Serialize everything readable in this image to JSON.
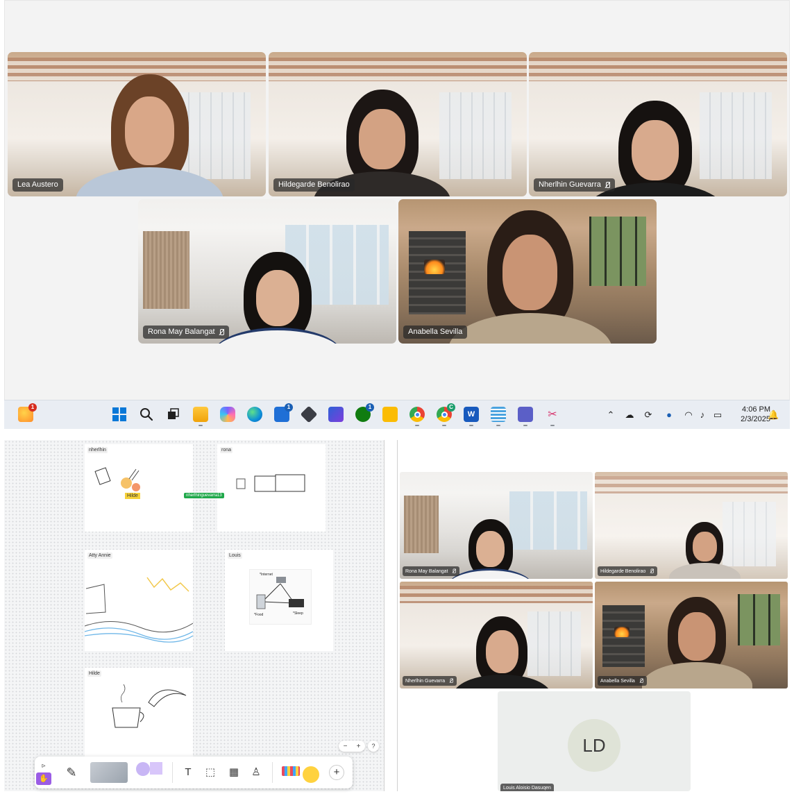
{
  "top_meeting": {
    "participants": [
      {
        "name": "Lea Austero",
        "muted": false
      },
      {
        "name": "Hildegarde Benolirao",
        "muted": false
      },
      {
        "name": "Nherlhin Guevarra",
        "muted": true
      },
      {
        "name": "Rona May Balangat",
        "muted": true
      },
      {
        "name": "Anabella Sevilla",
        "muted": false
      }
    ]
  },
  "taskbar": {
    "weather_badge": "1",
    "store_badge": "1",
    "xbox_badge": "1",
    "chrome_badge": "C",
    "time": "4:06 PM",
    "date": "2/3/2025",
    "icons": [
      "weather-icon",
      "start-icon",
      "search-icon",
      "task-view-icon",
      "file-explorer-icon",
      "copilot-icon",
      "edge-icon",
      "store-icon",
      "obsidian-icon",
      "visual-studio-icon",
      "xbox-icon",
      "keep-icon",
      "chrome-icon",
      "chrome-profile-icon",
      "word-icon",
      "notepad-icon",
      "teams-icon",
      "snipping-tool-icon"
    ],
    "tray_icons": [
      "chevron-up-icon",
      "onedrive-icon",
      "sync-icon",
      "microphone-icon",
      "wifi-icon",
      "volume-icon",
      "battery-icon",
      "notification-icon"
    ]
  },
  "whiteboard": {
    "frames": [
      {
        "label": "nherlhin"
      },
      {
        "label": "rona"
      },
      {
        "label": "Atty Annie"
      },
      {
        "label": "Louis"
      },
      {
        "label": "Hilde"
      }
    ],
    "sticky_note": "Hilde",
    "cursor_tag": "nherlhinguevarra13",
    "diagram_labels": {
      "internet": "*Internet",
      "food": "*Food",
      "sleep": "*Sleep"
    },
    "zoom_minus": "−",
    "zoom_plus": "+",
    "help": "?"
  },
  "bottom_meeting": {
    "participants": [
      {
        "name": "Rona May Balangat"
      },
      {
        "name": "Hildegarde Benolirao"
      },
      {
        "name": "Nherlhin Guevarra"
      },
      {
        "name": "Anabella Sevilla"
      },
      {
        "name": "Louis Aloisio Dasuqen"
      }
    ],
    "avatar_initials": "LD"
  },
  "colors": {
    "taskbar_bg": "#e9edf3",
    "cursor_tag": "#1fa84a",
    "sticky_note": "#f6d13a"
  }
}
